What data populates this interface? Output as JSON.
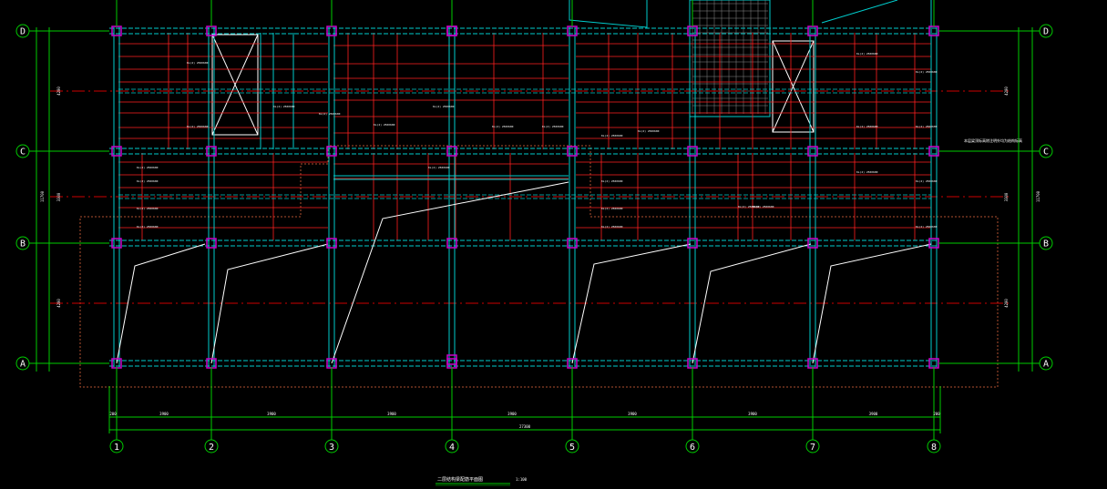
{
  "drawing": {
    "title": "二层结构梁配筋平面图",
    "scale": "1:100",
    "note": "本层梁顶标高除注明外均为结构标高"
  },
  "grid": {
    "rows": [
      "D",
      "C",
      "B",
      "A"
    ],
    "columns": [
      "1",
      "2",
      "3",
      "4",
      "5",
      "6",
      "7",
      "8"
    ],
    "column_spacing": [
      "3900",
      "3900",
      "3900",
      "3900",
      "3900",
      "3900",
      "3900"
    ],
    "overall_width": "27300",
    "edge_offset": "200",
    "row_spacing": [
      "4200",
      "3300",
      "4200"
    ],
    "overall_height": "11700"
  },
  "beam_label": "KL(2) 250X600",
  "colors": {
    "background": "#000000",
    "grid_axis": "#00cc00",
    "beams": "#00cccc",
    "rebar": "#ff2020",
    "center_line": "#cc0000",
    "columns": "#cc00cc",
    "slab_boundary": "#b05030",
    "openings": "#ffffff",
    "labels": "#ffffff"
  }
}
